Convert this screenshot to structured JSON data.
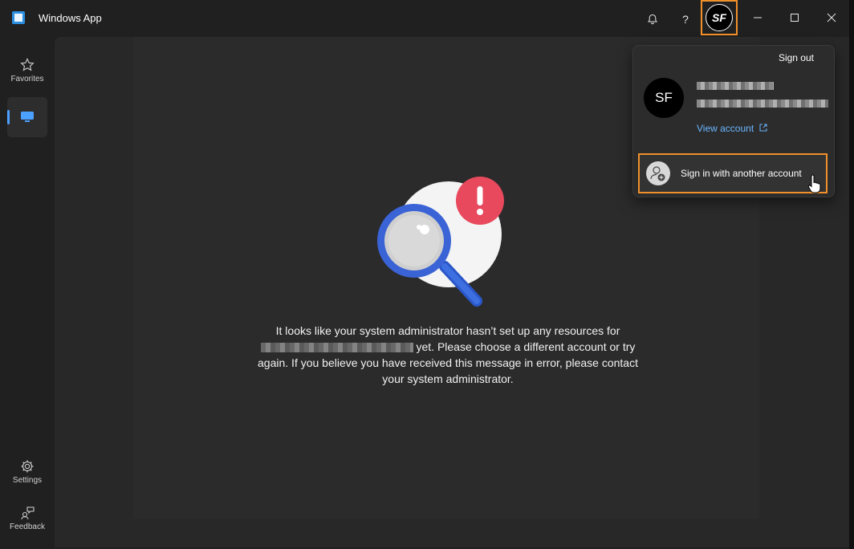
{
  "titlebar": {
    "app_title": "Windows App",
    "avatar_initials": "SF",
    "icons": [
      "bell-icon",
      "help-icon",
      "minimize-icon",
      "maximize-icon",
      "close-icon"
    ],
    "help_glyph": "?"
  },
  "sidebar": {
    "items": [
      {
        "label": "Favorites",
        "icon": "star-icon"
      },
      {
        "label": "",
        "icon": "monitor-icon"
      },
      {
        "label": "Settings",
        "icon": "gear-icon"
      },
      {
        "label": "Feedback",
        "icon": "feedback-icon"
      }
    ]
  },
  "main": {
    "message_part1": "It looks like your system administrator hasn’t set up any resources for",
    "message_part2": "yet. Please choose a different account or try again. If you believe you have received this message in error, please contact your system administrator."
  },
  "account_panel": {
    "sign_out": "Sign out",
    "avatar_initials": "SF",
    "view_account": "View account",
    "sign_in_another": "Sign in with another account"
  },
  "colors": {
    "accent_orange": "#f0902a",
    "link_blue": "#6ab7ff",
    "active_blue": "#4ca0ff"
  }
}
